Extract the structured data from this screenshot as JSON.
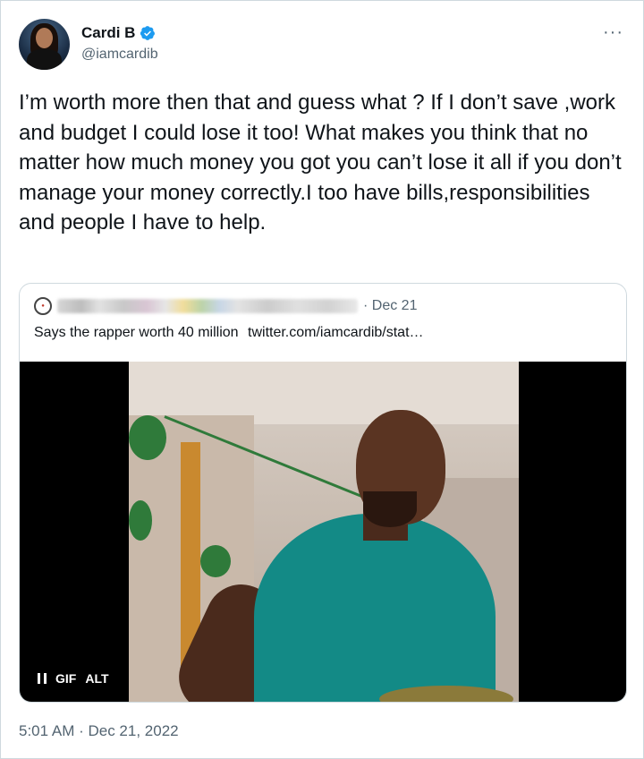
{
  "author": {
    "name": "Cardi B",
    "handle": "@iamcardib",
    "verified": true
  },
  "more_icon": "more-options-icon",
  "tweet": {
    "text": "I’m worth more then that and guess what ? If I don’t save ,work and budget I could lose it too! What makes you think that no matter how much money you got you can’t lose it all if you don’t manage your money correctly.I too have bills,responsibilities and people I have to help."
  },
  "quote": {
    "date": "· Dec 21",
    "text": "Says the rapper worth 40 million",
    "link": "twitter.com/iamcardib/stat…",
    "media": {
      "pause_icon": "pause-icon",
      "gif_badge": "GIF",
      "alt_badge": "ALT"
    }
  },
  "timestamp": "5:01 AM · Dec 21, 2022",
  "colors": {
    "text": "#0f1419",
    "secondary": "#536471",
    "border": "#cfd9de",
    "verified_blue": "#1d9bf0"
  }
}
